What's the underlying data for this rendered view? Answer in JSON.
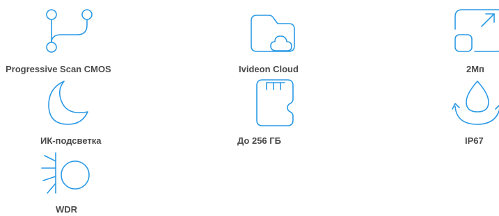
{
  "accent_color": "#2b9ae6",
  "label_color": "#4a4a4a",
  "features": [
    {
      "icon": "branch-icon",
      "label": "Progressive Scan CMOS"
    },
    {
      "icon": "cloud-folder-icon",
      "label": "Ivideon Cloud"
    },
    {
      "icon": "resolution-expand-icon",
      "label": "2Мп"
    },
    {
      "icon": "moon-icon",
      "label": "ИК-подсветка"
    },
    {
      "icon": "sd-card-icon",
      "label": "До 256 ГБ"
    },
    {
      "icon": "water-drop-icon",
      "label": "IP67"
    },
    {
      "icon": "sun-wdr-icon",
      "label": "WDR"
    }
  ]
}
